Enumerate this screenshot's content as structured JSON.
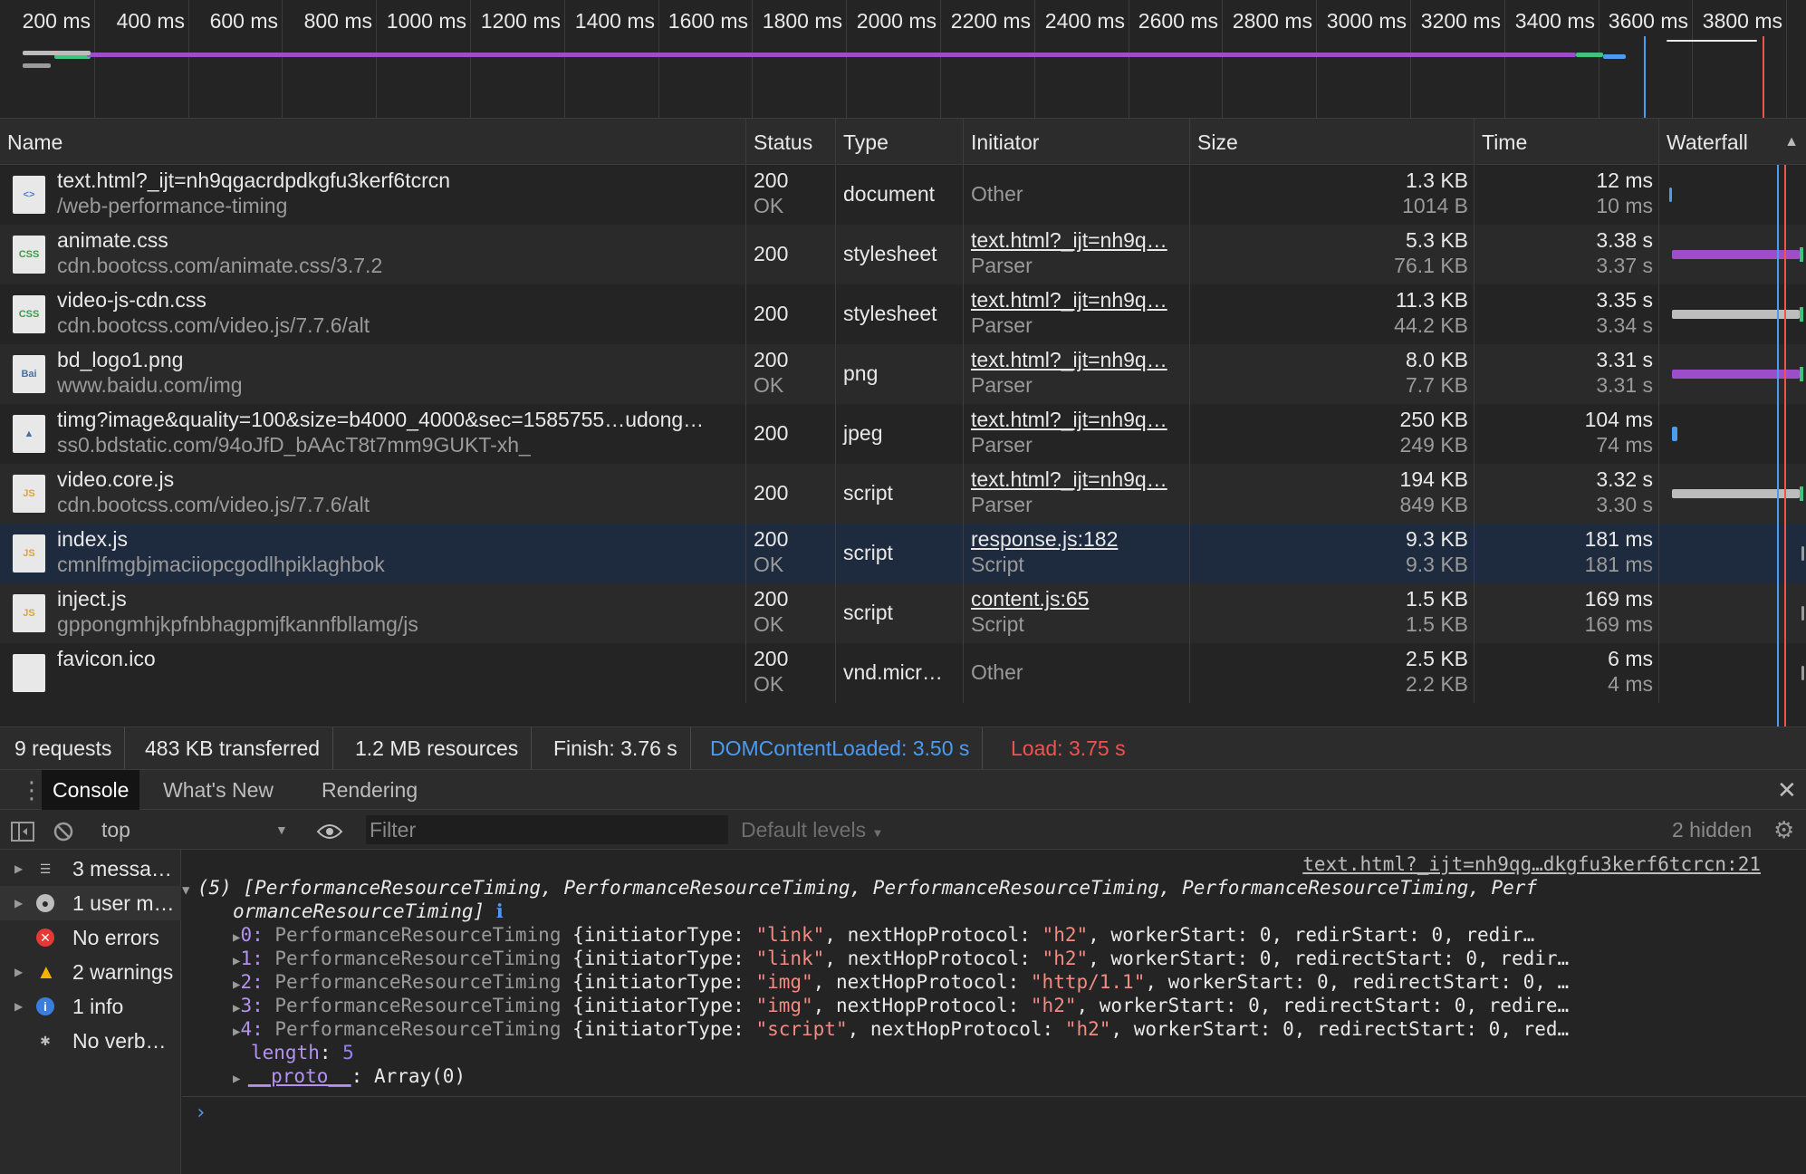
{
  "overview": {
    "ticks": [
      "200 ms",
      "400 ms",
      "600 ms",
      "800 ms",
      "1000 ms",
      "1200 ms",
      "1400 ms",
      "1600 ms",
      "1800 ms",
      "2000 ms",
      "2200 ms",
      "2400 ms",
      "2600 ms",
      "2800 ms",
      "3000 ms",
      "3200 ms",
      "3400 ms",
      "3600 ms",
      "3800 ms",
      "40"
    ]
  },
  "columns": {
    "name": "Name",
    "status": "Status",
    "type": "Type",
    "initiator": "Initiator",
    "size": "Size",
    "time": "Time",
    "waterfall": "Waterfall"
  },
  "requests": [
    {
      "name": "text.html?_ijt=nh9qgacrdpdkgfu3kerf6tcrcn",
      "url": "/web-performance-timing",
      "status": "200",
      "status_text": "OK",
      "type": "document",
      "initiator": "Other",
      "initiator_sub": "",
      "size": "1.3 KB",
      "size_sub": "1014 B",
      "time": "12 ms",
      "time_sub": "10 ms",
      "icon": "html-doc-icon",
      "icon_text": "<>"
    },
    {
      "name": "animate.css",
      "url": "cdn.bootcss.com/animate.css/3.7.2",
      "status": "200",
      "status_text": "",
      "type": "stylesheet",
      "initiator": "text.html?_ijt=nh9q…",
      "initiator_sub": "Parser",
      "size": "5.3 KB",
      "size_sub": "76.1 KB",
      "time": "3.38 s",
      "time_sub": "3.37 s",
      "icon": "css-file-icon",
      "icon_text": "CSS"
    },
    {
      "name": "video-js-cdn.css",
      "url": "cdn.bootcss.com/video.js/7.7.6/alt",
      "status": "200",
      "status_text": "",
      "type": "stylesheet",
      "initiator": "text.html?_ijt=nh9q…",
      "initiator_sub": "Parser",
      "size": "11.3 KB",
      "size_sub": "44.2 KB",
      "time": "3.35 s",
      "time_sub": "3.34 s",
      "icon": "css-file-icon",
      "icon_text": "CSS"
    },
    {
      "name": "bd_logo1.png",
      "url": "www.baidu.com/img",
      "status": "200",
      "status_text": "OK",
      "type": "png",
      "initiator": "text.html?_ijt=nh9q…",
      "initiator_sub": "Parser",
      "size": "8.0 KB",
      "size_sub": "7.7 KB",
      "time": "3.31 s",
      "time_sub": "3.31 s",
      "icon": "image-file-icon",
      "icon_text": "Bai"
    },
    {
      "name": "timg?image&quality=100&size=b4000_4000&sec=1585755…udong…",
      "url": "ss0.bdstatic.com/94oJfD_bAAcT8t7mm9GUKT-xh_",
      "status": "200",
      "status_text": "",
      "type": "jpeg",
      "initiator": "text.html?_ijt=nh9q…",
      "initiator_sub": "Parser",
      "size": "250 KB",
      "size_sub": "249 KB",
      "time": "104 ms",
      "time_sub": "74 ms",
      "icon": "image-file-icon",
      "icon_text": "▲"
    },
    {
      "name": "video.core.js",
      "url": "cdn.bootcss.com/video.js/7.7.6/alt",
      "status": "200",
      "status_text": "",
      "type": "script",
      "initiator": "text.html?_ijt=nh9q…",
      "initiator_sub": "Parser",
      "size": "194 KB",
      "size_sub": "849 KB",
      "time": "3.32 s",
      "time_sub": "3.30 s",
      "icon": "js-file-icon",
      "icon_text": "JS"
    },
    {
      "name": "index.js",
      "url": "cmnlfmgbjmaciiopcgodlhpiklaghbok",
      "status": "200",
      "status_text": "OK",
      "type": "script",
      "initiator": "response.js:182",
      "initiator_sub": "Script",
      "size": "9.3 KB",
      "size_sub": "9.3 KB",
      "time": "181 ms",
      "time_sub": "181 ms",
      "icon": "js-file-icon",
      "icon_text": "JS"
    },
    {
      "name": "inject.js",
      "url": "gppongmhjkpfnbhagpmjfkannfbllamg/js",
      "status": "200",
      "status_text": "OK",
      "type": "script",
      "initiator": "content.js:65",
      "initiator_sub": "Script",
      "size": "1.5 KB",
      "size_sub": "1.5 KB",
      "time": "169 ms",
      "time_sub": "169 ms",
      "icon": "js-file-icon",
      "icon_text": "JS"
    },
    {
      "name": "favicon.ico",
      "url": "",
      "status": "200",
      "status_text": "OK",
      "type": "vnd.micr…",
      "initiator": "Other",
      "initiator_sub": "",
      "size": "2.5 KB",
      "size_sub": "2.2 KB",
      "time": "6 ms",
      "time_sub": "4 ms",
      "icon": "blank-file-icon",
      "icon_text": ""
    }
  ],
  "summary": {
    "requests": "9 requests",
    "transferred": "483 KB transferred",
    "resources": "1.2 MB resources",
    "finish": "Finish: 3.76 s",
    "dcl": "DOMContentLoaded: 3.50 s",
    "load": "Load: 3.75 s",
    "dcl_color": "#4d9bef",
    "load_color": "#ef5350"
  },
  "drawer": {
    "tabs": [
      "Console",
      "What's New",
      "Rendering"
    ],
    "active": "Console"
  },
  "console_toolbar": {
    "context": "top",
    "filter_placeholder": "Filter",
    "levels": "Default levels",
    "hidden": "2 hidden"
  },
  "sidebar": [
    {
      "label": "3 messa…",
      "icon": "list-icon"
    },
    {
      "label": "1 user m…",
      "icon": "user-icon"
    },
    {
      "label": "No errors",
      "icon": "error-icon"
    },
    {
      "label": "2 warnings",
      "icon": "warning-icon"
    },
    {
      "label": "1 info",
      "icon": "info-icon"
    },
    {
      "label": "No verb…",
      "icon": "bug-icon"
    }
  ],
  "console": {
    "source": "text.html?_ijt=nh9qg…dkgfu3kerf6tcrcn:21",
    "header_line1": "(5) [PerformanceResourceTiming, PerformanceResourceTiming, PerformanceResourceTiming, PerformanceResourceTiming, Perf",
    "header_line2": "ormanceResourceTiming]",
    "entries": [
      {
        "idx": "0",
        "initiator": "\"link\"",
        "protocol": "\"h2\"",
        "tail": "redirStart: 0, redir…"
      },
      {
        "idx": "1",
        "initiator": "\"link\"",
        "protocol": "\"h2\"",
        "tail": "redirectStart: 0, redir…"
      },
      {
        "idx": "2",
        "initiator": "\"img\"",
        "protocol": "\"http/1.1\"",
        "tail": "redirectStart: 0, …"
      },
      {
        "idx": "3",
        "initiator": "\"img\"",
        "protocol": "\"h2\"",
        "tail": "redirectStart: 0, redire…"
      },
      {
        "idx": "4",
        "initiator": "\"script\"",
        "protocol": "\"h2\"",
        "tail": "redirectStart: 0, red…"
      }
    ],
    "length_key": "length",
    "length_val": "5",
    "proto_key": "__proto__",
    "proto_val": "Array(0)",
    "entry_class": "PerformanceResourceTiming",
    "initiator_key": "initiatorType",
    "protocol_key": "nextHopProtocol",
    "worker": "workerStart: 0"
  }
}
